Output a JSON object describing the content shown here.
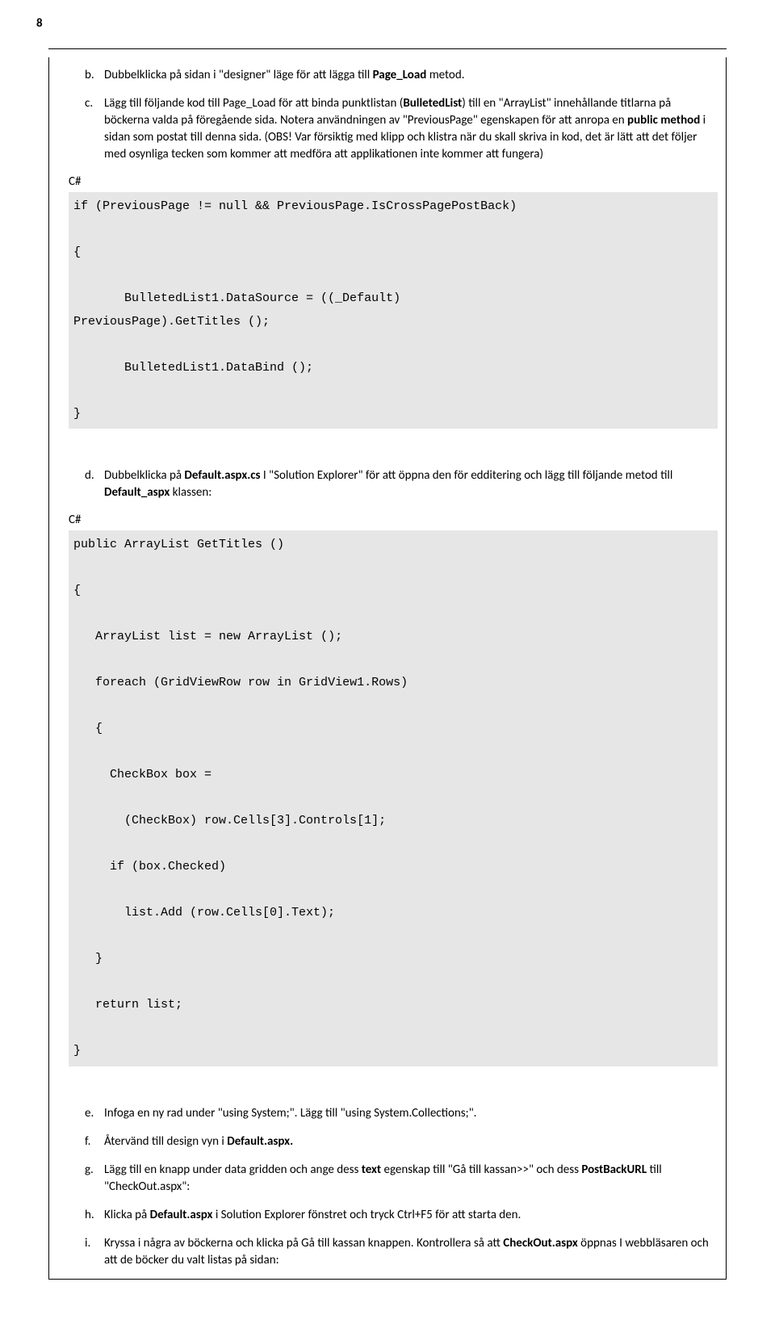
{
  "pageNumber": "8",
  "items": {
    "b": {
      "letter": "b.",
      "text_pre": "Dubbelklicka på sidan i \"designer\" läge för att lägga till ",
      "text_bold": "Page_Load",
      "text_post": " metod."
    },
    "c": {
      "letter": "c.",
      "p1a": "Lägg till följande kod till Page_Load för att binda punktlistan (",
      "p1b": "BulletedList",
      "p1c": ") till en \"ArrayList\" innehållande titlarna på böckerna valda på föregående sida. Notera användningen av \"PreviousPage\" egenskapen för att anropa en ",
      "p1d": "public method",
      "p1e": " i sidan som postat till denna sida. (OBS! Var försiktig med klipp och klistra när du skall skriva in kod, det är lätt att det följer med osynliga tecken som kommer att medföra att applikationen inte kommer att fungera)"
    },
    "csharp_label": "C#",
    "code1": "if (PreviousPage != null && PreviousPage.IsCrossPagePostBack)\n\n{\n\n       BulletedList1.DataSource = ((_Default)\nPreviousPage).GetTitles ();\n\n       BulletedList1.DataBind ();\n\n}",
    "d": {
      "letter": "d.",
      "t1": "Dubbelklicka på ",
      "t2": "Default.aspx.cs",
      "t3": " I \"Solution Explorer\" för att öppna den för edditering och lägg till följande metod till ",
      "t4": "Default_aspx",
      "t5": " klassen:"
    },
    "code2": "public ArrayList GetTitles ()\n\n{\n\n   ArrayList list = new ArrayList ();\n\n   foreach (GridViewRow row in GridView1.Rows)\n\n   {\n\n     CheckBox box =\n\n       (CheckBox) row.Cells[3].Controls[1];\n\n     if (box.Checked)\n\n       list.Add (row.Cells[0].Text);\n\n   }\n\n   return list;\n\n}",
    "e": {
      "letter": "e.",
      "text": "Infoga en ny rad under \"using System;\". Lägg till \"using System.Collections;\"."
    },
    "f": {
      "letter": "f.",
      "t1": "Återvänd till design vyn i ",
      "t2": "Default.aspx."
    },
    "g": {
      "letter": "g.",
      "t1": "Lägg till en knapp under data gridden och ange dess ",
      "t2": "text",
      "t3": " egenskap till \"Gå till kassan>>\" och dess ",
      "t4": "PostBackURL",
      "t5": " till \"CheckOut.aspx\":"
    },
    "h": {
      "letter": "h.",
      "t1": "Klicka på ",
      "t2": "Default.aspx",
      "t3": " i Solution Explorer fönstret och tryck Ctrl+F5 för att starta den."
    },
    "i": {
      "letter": "i.",
      "t1": "Kryssa i några av böckerna och klicka på Gå till kassan knappen. Kontrollera så att ",
      "t2": "CheckOut.aspx",
      "t3": " öppnas I webbläsaren och att de böcker du valt listas på sidan:"
    }
  }
}
